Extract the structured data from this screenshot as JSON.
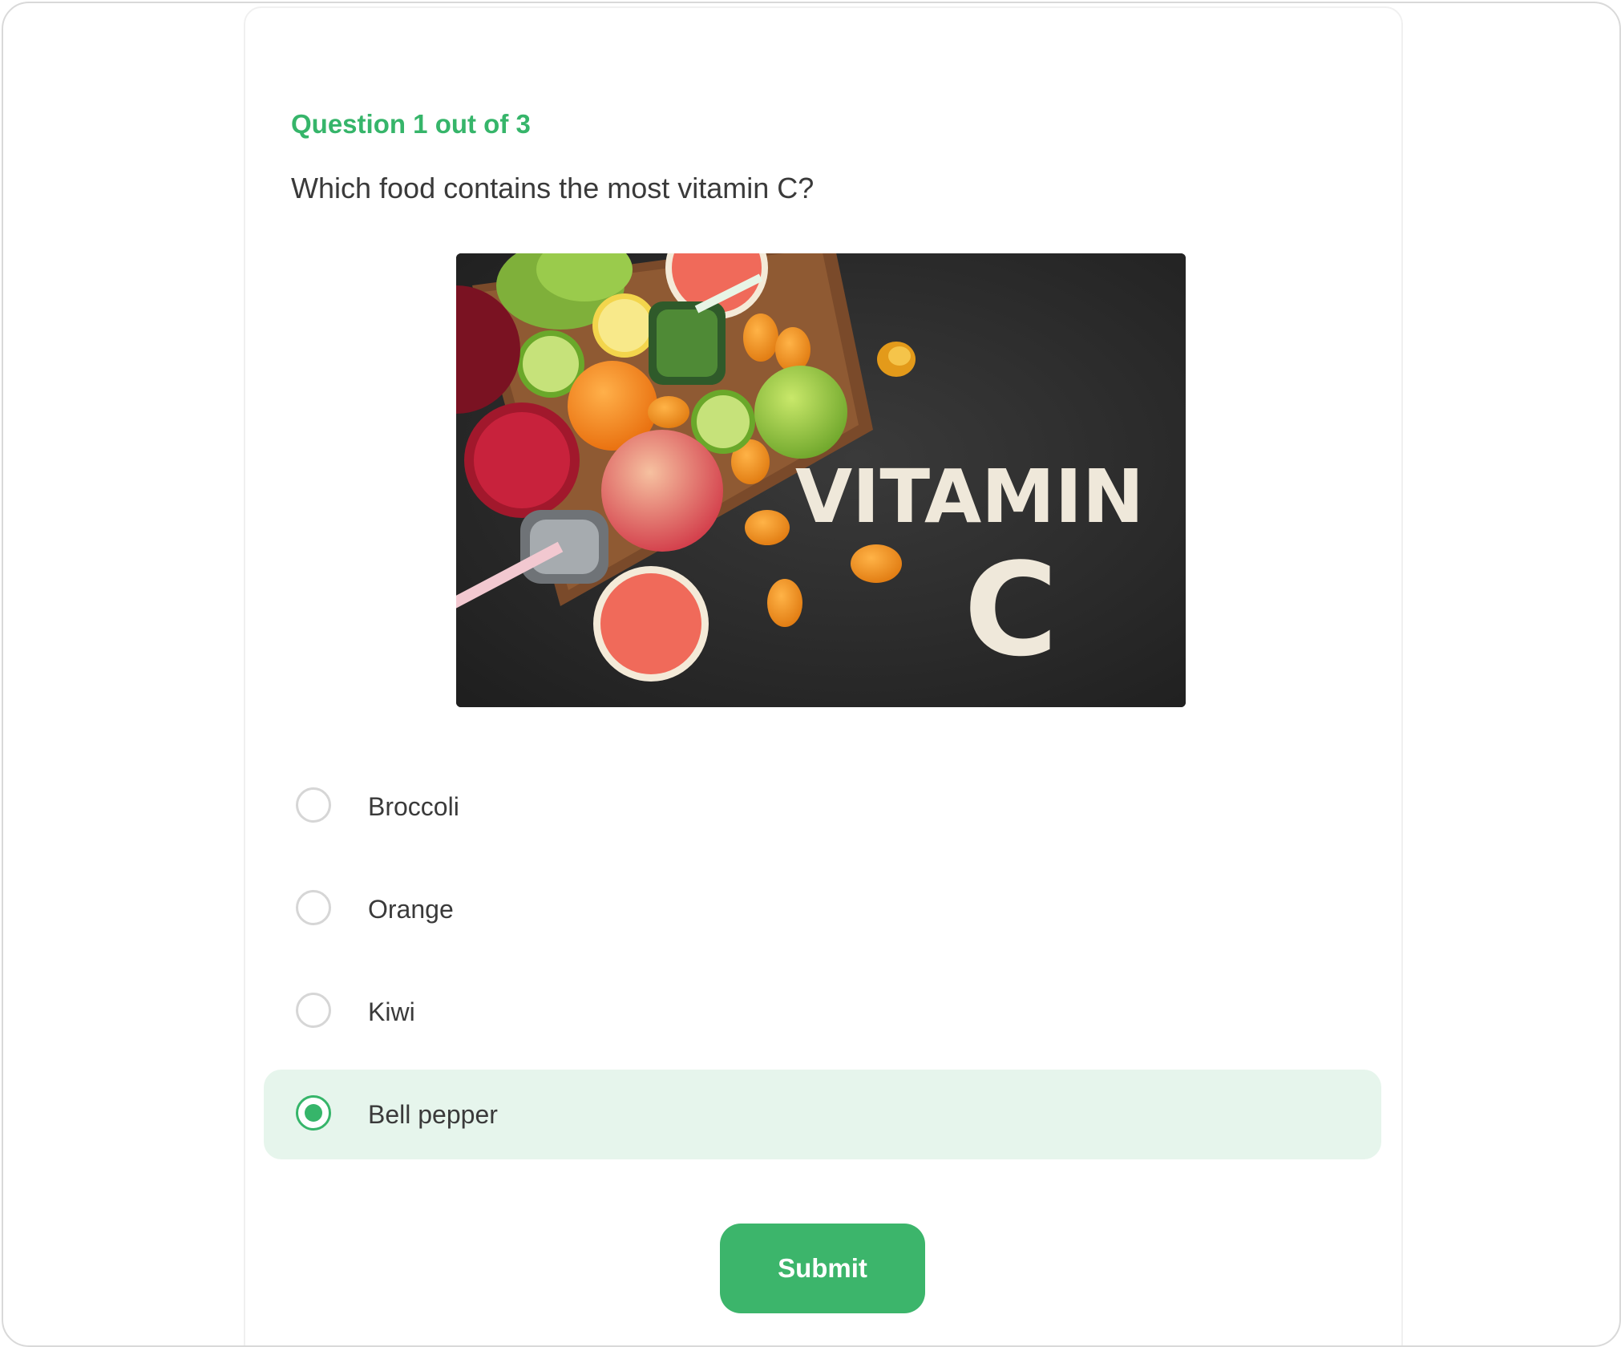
{
  "quiz": {
    "progress_label": "Question 1 out of 3",
    "question_text": "Which food contains the most vitamin C?",
    "image": {
      "description_icon": "vitamin-c-fruits-image",
      "word": "VITAMIN",
      "letter": "C"
    },
    "options": [
      {
        "label": "Broccoli",
        "selected": false
      },
      {
        "label": "Orange",
        "selected": false
      },
      {
        "label": "Kiwi",
        "selected": false
      },
      {
        "label": "Bell pepper",
        "selected": true
      }
    ],
    "submit_label": "Submit"
  },
  "colors": {
    "accent": "#36b56a",
    "selected_bg": "#e6f5ec",
    "text": "#3a3a3a",
    "radio_border": "#d6d6d6"
  }
}
